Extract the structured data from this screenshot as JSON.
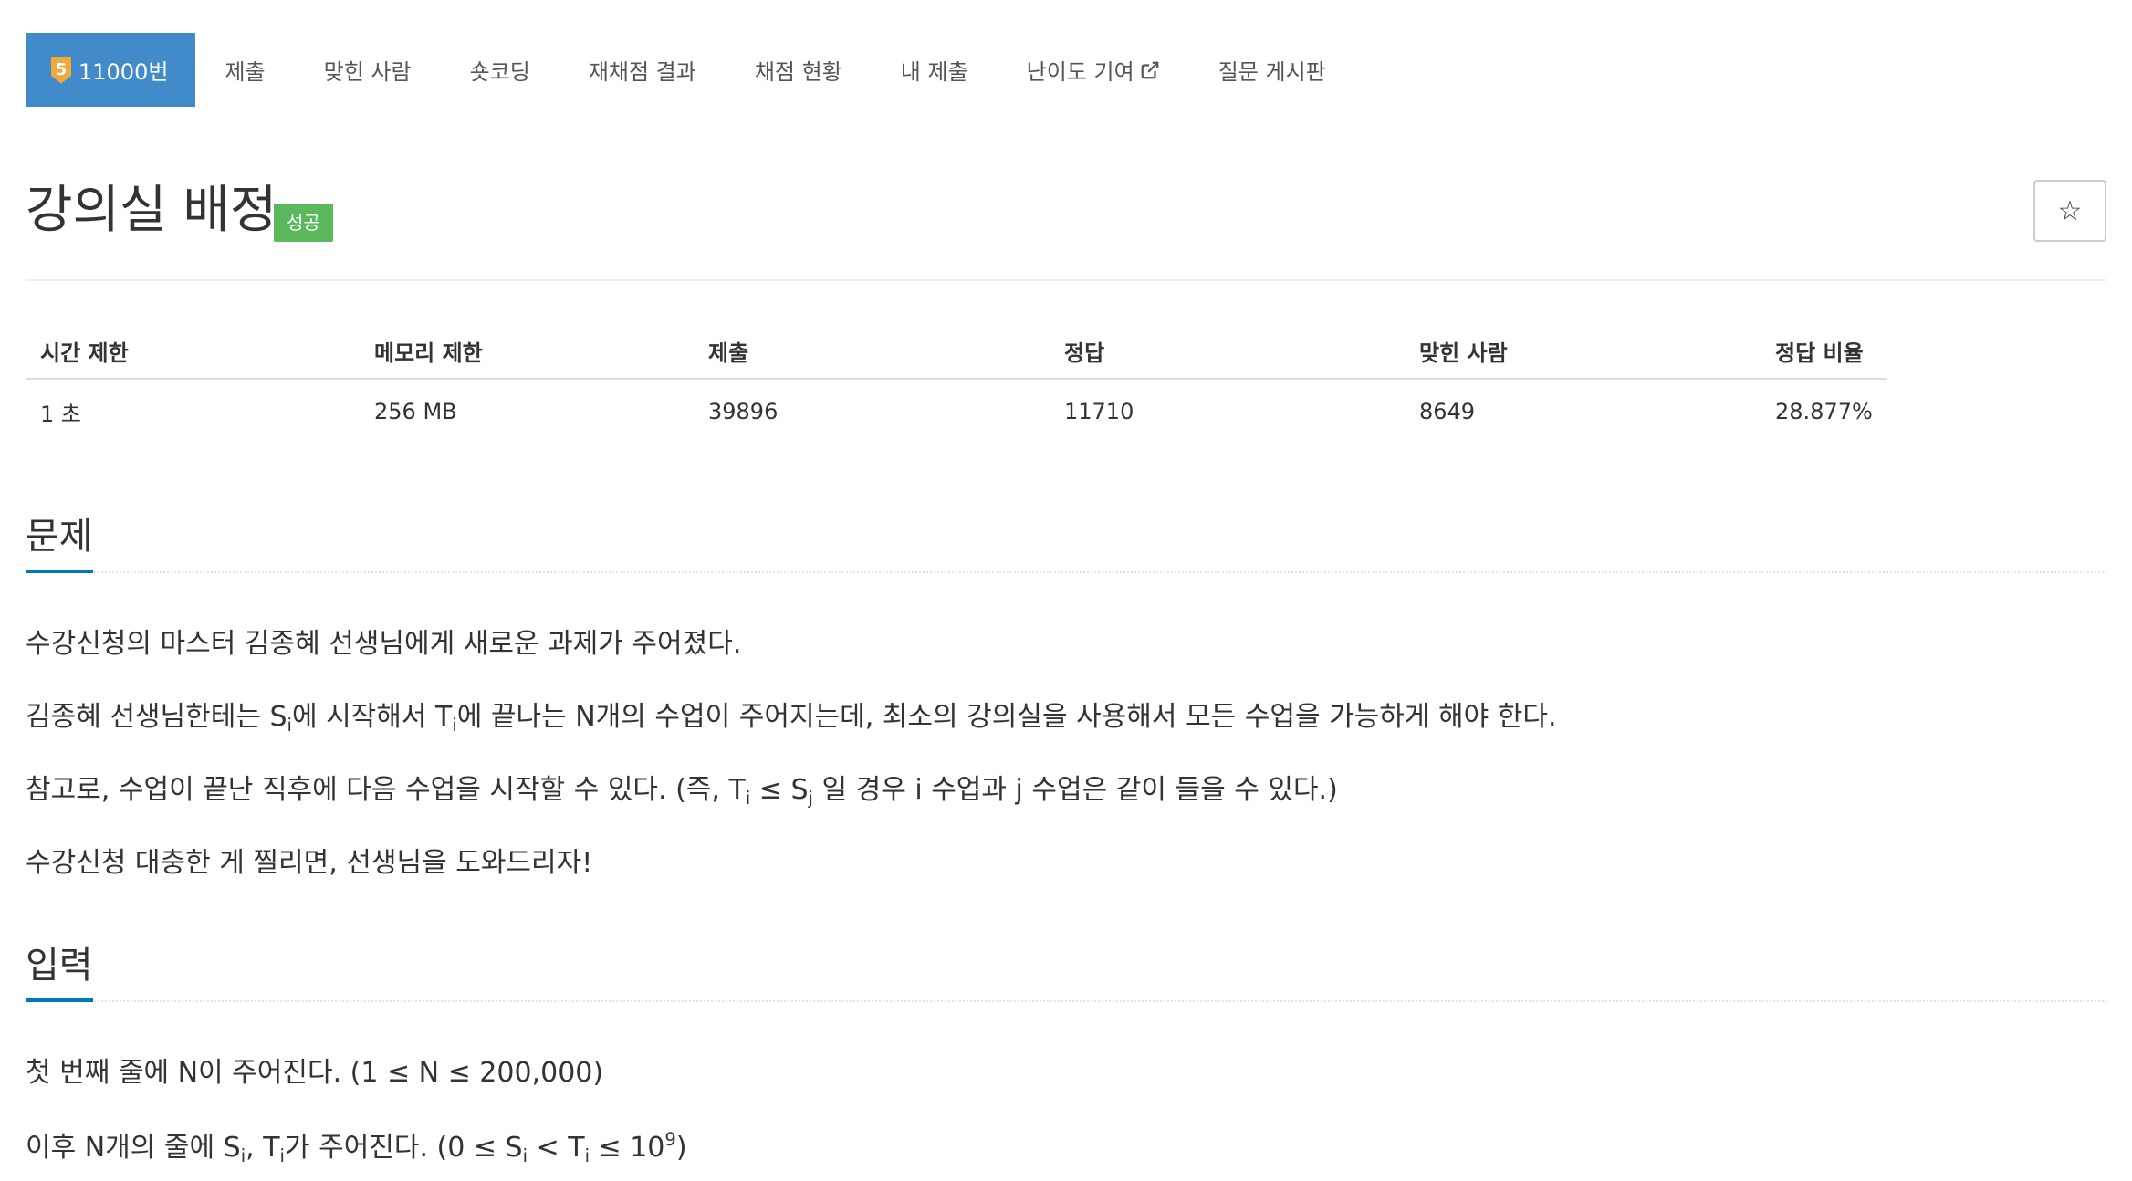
{
  "nav": {
    "tier_number": "5",
    "problem_tab": "11000번",
    "tabs": [
      "제출",
      "맞힌 사람",
      "숏코딩",
      "재채점 결과",
      "채점 현황",
      "내 제출"
    ],
    "difficulty_tab": "난이도 기여",
    "board_tab": "질문 게시판",
    "active_color": "#428bca"
  },
  "title": {
    "text": "강의실 배정",
    "badge": "성공",
    "badge_color": "#5cb85c",
    "star": "☆"
  },
  "info": {
    "headers": [
      "시간 제한",
      "메모리 제한",
      "제출",
      "정답",
      "맞힌 사람",
      "정답 비율"
    ],
    "values": [
      "1 초",
      "256 MB",
      "39896",
      "11710",
      "8649",
      "28.877%"
    ]
  },
  "problem": {
    "heading": "문제",
    "line1": "수강신청의 마스터 김종혜 선생님에게 새로운 과제가 주어졌다.",
    "line2": {
      "a": "김종혜 선생님한테는 S",
      "sub1": "i",
      "b": "에 시작해서 T",
      "sub2": "i",
      "c": "에 끝나는 N개의 수업이 주어지는데, 최소의 강의실을 사용해서 모든 수업을 가능하게 해야 한다."
    },
    "line3": {
      "a": "참고로, 수업이 끝난 직후에 다음 수업을 시작할 수 있다. (즉, T",
      "sub1": "i",
      "b": " ≤ S",
      "sub2": "j",
      "c": " 일 경우 i 수업과 j 수업은 같이 들을 수 있다.)"
    },
    "line4": "수강신청 대충한 게 찔리면, 선생님을 도와드리자!"
  },
  "input": {
    "heading": "입력",
    "line1": "첫 번째 줄에 N이 주어진다. (1 ≤ N ≤ 200,000)",
    "line2": {
      "a": "이후 N개의 줄에 S",
      "sub1": "i",
      "b": ", T",
      "sub2": "i",
      "c": "가 주어진다. (0 ≤ S",
      "sub3": "i",
      "d": " < T",
      "sub4": "i",
      "e": " ≤ 10",
      "sup1": "9",
      "f": ")"
    }
  }
}
